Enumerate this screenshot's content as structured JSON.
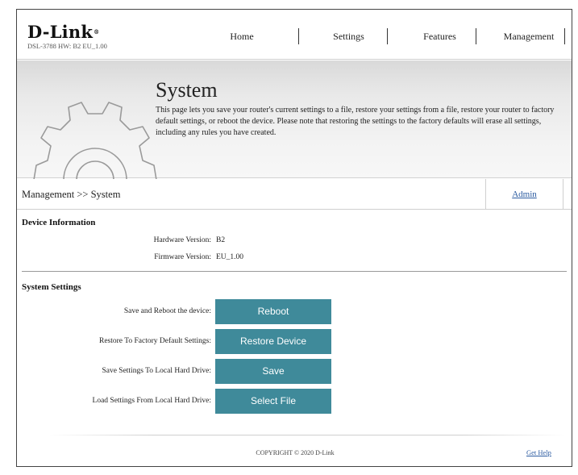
{
  "header": {
    "logo": "D-Link",
    "logo_mark": "®",
    "hw_line": "DSL-3788  HW: B2  EU_1.00",
    "nav": [
      {
        "label": "Home"
      },
      {
        "label": "Settings"
      },
      {
        "label": "Features"
      },
      {
        "label": "Management"
      }
    ]
  },
  "banner": {
    "title": "System",
    "description": "This page lets you save your router's current settings to a file, restore your settings from a file, restore your router to factory default settings, or reboot the device. Please note that restoring the settings to the factory defaults will erase all settings, including any rules you have created.",
    "icon": "gear-icon"
  },
  "breadcrumb": {
    "path": "Management >> System",
    "admin_link": "Admin"
  },
  "device_info": {
    "title": "Device Information",
    "hardware_label": "Hardware Version:",
    "hardware_value": "B2",
    "firmware_label": "Firmware Version:",
    "firmware_value": "EU_1.00"
  },
  "system_settings": {
    "title": "System Settings",
    "rows": [
      {
        "label": "Save and Reboot the device:",
        "button": "Reboot"
      },
      {
        "label": "Restore To Factory Default Settings:",
        "button": "Restore Device"
      },
      {
        "label": "Save Settings To Local Hard Drive:",
        "button": "Save"
      },
      {
        "label": "Load Settings From Local Hard Drive:",
        "button": "Select File"
      }
    ]
  },
  "footer": {
    "copyright": "COPYRIGHT © 2020 D-Link",
    "help": "Get Help"
  },
  "colors": {
    "button": "#3f8a9a",
    "link": "#2a5aa0"
  }
}
